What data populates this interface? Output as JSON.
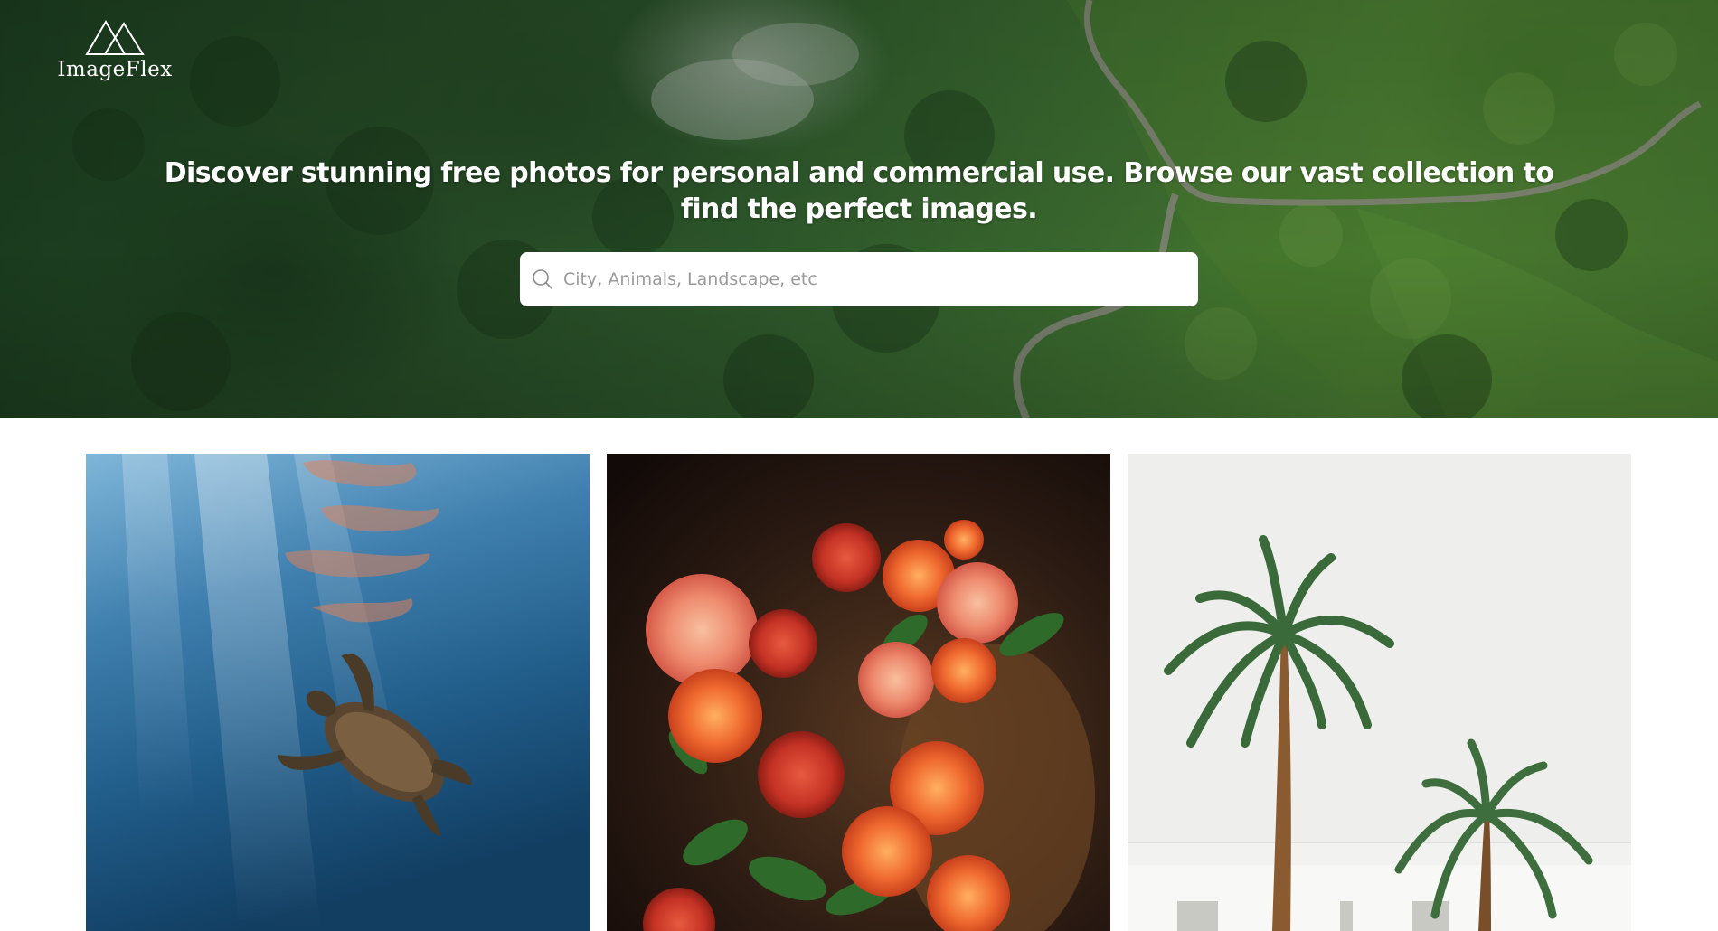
{
  "brand": {
    "name": "ImageFlex",
    "logo_icon": "mountain-logo-icon"
  },
  "hero": {
    "headline": "Discover stunning free photos for personal and commercial use. Browse our vast collection to find the perfect images.",
    "background": "aerial-green-mountains-with-winding-road"
  },
  "search": {
    "placeholder": "City, Animals, Landscape, etc",
    "value": "",
    "icon": "search-icon"
  },
  "gallery": {
    "photos": [
      {
        "subject": "sea-turtle-underwater"
      },
      {
        "subject": "orange-dahlia-flowers"
      },
      {
        "subject": "palm-trees-white-building"
      }
    ]
  },
  "colors": {
    "hero_green": "#2f5a2c",
    "search_bg": "#ffffff",
    "placeholder": "#9a9a9a",
    "headline": "#ffffff"
  }
}
